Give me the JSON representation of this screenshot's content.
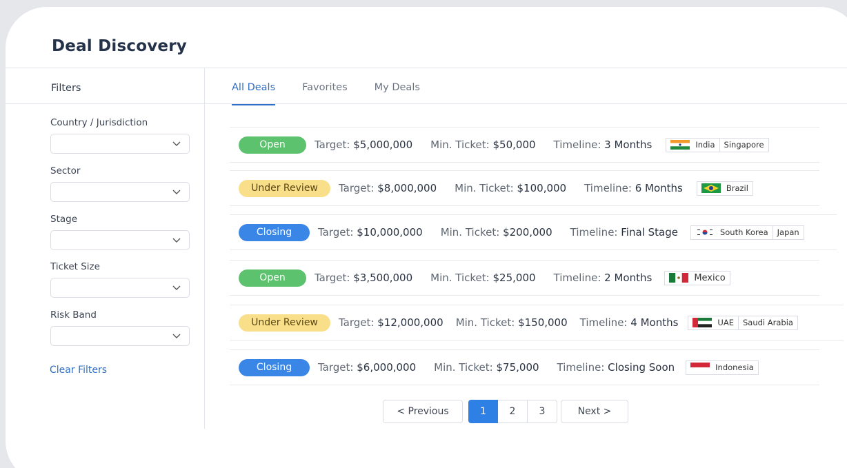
{
  "page": {
    "title": "Deal Discovery"
  },
  "filters": {
    "title": "Filters",
    "groups": [
      {
        "label": "Country / Jurisdiction",
        "value": ""
      },
      {
        "label": "Sector",
        "value": ""
      },
      {
        "label": "Stage",
        "value": ""
      },
      {
        "label": "Ticket Size",
        "value": ""
      },
      {
        "label": "Risk Band",
        "value": ""
      }
    ],
    "clear_label": "Clear Filters"
  },
  "tabs": [
    {
      "label": "All Deals",
      "active": true
    },
    {
      "label": "Favorites",
      "active": false
    },
    {
      "label": "My Deals",
      "active": false
    }
  ],
  "deal_labels": {
    "target": "Target:",
    "min_ticket": "Min. Ticket:",
    "timeline": "Timeline:"
  },
  "deals": [
    {
      "status": "Open",
      "target": "$5,000,000",
      "min_ticket": "$50,000",
      "timeline": "3 Months",
      "countries": [
        "India",
        "Singapore"
      ]
    },
    {
      "status": "Under Review",
      "target": "$8,000,000",
      "min_ticket": "$100,000",
      "timeline": "6 Months",
      "countries": [
        "Brazil"
      ]
    },
    {
      "status": "Closing",
      "target": "$10,000,000",
      "min_ticket": "$200,000",
      "timeline": "Final Stage",
      "countries": [
        "South Korea",
        "Japan"
      ]
    },
    {
      "status": "Open",
      "target": "$3,500,000",
      "min_ticket": "$25,000",
      "timeline": "2 Months",
      "countries": [
        "Mexico"
      ]
    },
    {
      "status": "Under Review",
      "target": "$12,000,000",
      "min_ticket": "$150,000",
      "timeline": "4 Months",
      "countries": [
        "UAE",
        "Saudi Arabia"
      ]
    },
    {
      "status": "Closing",
      "target": "$6,000,000",
      "min_ticket": "$75,000",
      "timeline": "Closing Soon",
      "countries": [
        "Indonesia"
      ]
    }
  ],
  "status_colors": {
    "Open": "#5cc26e",
    "Under Review": "#f9df8a",
    "Closing": "#3a86e6"
  },
  "pagination": {
    "previous_label": "< Previous",
    "next_label": "Next >",
    "pages": [
      "1",
      "2",
      "3"
    ],
    "current": "1"
  }
}
